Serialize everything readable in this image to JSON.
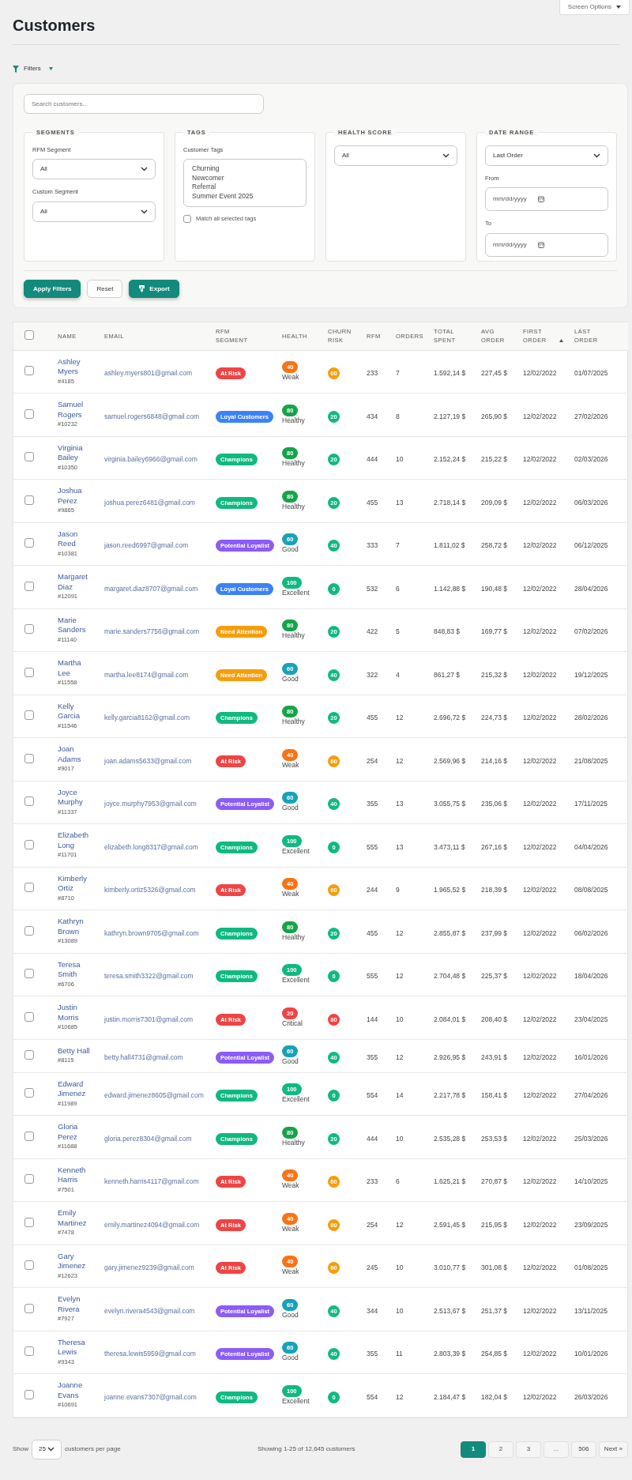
{
  "screen_options": {
    "label": "Screen Options",
    "expanded": false
  },
  "title": "Customers",
  "filters_toggle": {
    "label": "Filters",
    "expanded": true
  },
  "filters": {
    "search": {
      "placeholder": "Search customers..."
    },
    "groups": [
      {
        "legend": "SEGMENTS",
        "fields": [
          {
            "kind": "select",
            "label": "RFM Segment",
            "value": "All"
          },
          {
            "kind": "select",
            "label": "Custom Segment",
            "value": "All"
          }
        ]
      },
      {
        "legend": "TAGS",
        "fields": [
          {
            "kind": "listbox",
            "label": "Customer Tags",
            "options": [
              "Churning",
              "Newcomer",
              "Referral",
              "Summer Event 2025"
            ]
          },
          {
            "kind": "checkbox",
            "label": "Match all selected tags",
            "checked": false
          }
        ]
      },
      {
        "legend": "HEALTH SCORE",
        "fields": [
          {
            "kind": "select",
            "value": "All"
          }
        ]
      },
      {
        "legend": "DATE RANGE",
        "fields": [
          {
            "kind": "select",
            "value": "Last Order"
          },
          {
            "kind": "date",
            "label": "From",
            "placeholder": "mm/dd/yyyy"
          },
          {
            "kind": "date",
            "label": "To",
            "placeholder": "mm/dd/yyyy"
          }
        ]
      }
    ],
    "actions": [
      {
        "kind": "primary",
        "label": "Apply Filters"
      },
      {
        "kind": "secondary",
        "label": "Reset"
      },
      {
        "kind": "export",
        "label": "Export"
      }
    ]
  },
  "table": {
    "select_all": {
      "checked": false
    },
    "columns": [
      {
        "label": "NAME"
      },
      {
        "label": "EMAIL"
      },
      {
        "label": "RFM SEGMENT"
      },
      {
        "label": "HEALTH"
      },
      {
        "label": "CHURN RISK"
      },
      {
        "label": "RFM"
      },
      {
        "label": "ORDERS"
      },
      {
        "label": "TOTAL SPENT"
      },
      {
        "label": "AVG ORDER"
      },
      {
        "label": "FIRST ORDER",
        "sort_ascending": true
      },
      {
        "label": "LAST ORDER"
      }
    ],
    "rows": [
      {
        "checked": false,
        "name": "Ashley Myers",
        "id": "#4185",
        "email": "ashley.myers801@gmail.com",
        "segment": {
          "label": "At Risk",
          "color": "#ef4444"
        },
        "health": {
          "score": "40",
          "label": "Weak",
          "color": "#f97316"
        },
        "churn": {
          "value": "60",
          "color": "#f59e0b"
        },
        "rfm": "233",
        "orders": "7",
        "total_spent": "1.592,14 $",
        "avg_order": "227,45 $",
        "first_order": "12/02/2022",
        "last_order": "01/07/2025"
      },
      {
        "checked": false,
        "name": "Samuel Rogers",
        "id": "#10232",
        "email": "samuel.rogers6848@gmail.com",
        "segment": {
          "label": "Loyal Customers",
          "color": "#3b82f6"
        },
        "health": {
          "score": "80",
          "label": "Healthy",
          "color": "#16a34a"
        },
        "churn": {
          "value": "20",
          "color": "#10b981"
        },
        "rfm": "434",
        "orders": "8",
        "total_spent": "2.127,19 $",
        "avg_order": "265,90 $",
        "first_order": "12/02/2022",
        "last_order": "27/02/2026"
      },
      {
        "checked": false,
        "name": "Virginia Bailey",
        "id": "#10350",
        "email": "virginia.bailey6966@gmail.com",
        "segment": {
          "label": "Champions",
          "color": "#10b981"
        },
        "health": {
          "score": "80",
          "label": "Healthy",
          "color": "#16a34a"
        },
        "churn": {
          "value": "20",
          "color": "#10b981"
        },
        "rfm": "444",
        "orders": "10",
        "total_spent": "2.152,24 $",
        "avg_order": "215,22 $",
        "first_order": "12/02/2022",
        "last_order": "02/03/2026"
      },
      {
        "checked": false,
        "name": "Joshua Perez",
        "id": "#9865",
        "email": "joshua.perez6481@gmail.com",
        "segment": {
          "label": "Champions",
          "color": "#10b981"
        },
        "health": {
          "score": "80",
          "label": "Healthy",
          "color": "#16a34a"
        },
        "churn": {
          "value": "20",
          "color": "#10b981"
        },
        "rfm": "455",
        "orders": "13",
        "total_spent": "2.718,14 $",
        "avg_order": "209,09 $",
        "first_order": "12/02/2022",
        "last_order": "06/03/2026"
      },
      {
        "checked": false,
        "name": "Jason Reed",
        "id": "#10381",
        "email": "jason.reed6997@gmail.com",
        "segment": {
          "label": "Potential Loyalist",
          "color": "#8b5cf6"
        },
        "health": {
          "score": "60",
          "label": "Good",
          "color": "#17a2b8"
        },
        "churn": {
          "value": "40",
          "color": "#10b981"
        },
        "rfm": "333",
        "orders": "7",
        "total_spent": "1.811,02 $",
        "avg_order": "258,72 $",
        "first_order": "12/02/2022",
        "last_order": "06/12/2025"
      },
      {
        "checked": false,
        "name": "Margaret Diaz",
        "id": "#12091",
        "email": "margaret.diaz8707@gmail.com",
        "segment": {
          "label": "Loyal Customers",
          "color": "#3b82f6"
        },
        "health": {
          "score": "100",
          "label": "Excellent",
          "color": "#10b981"
        },
        "churn": {
          "value": "0",
          "color": "#10b981"
        },
        "rfm": "532",
        "orders": "6",
        "total_spent": "1.142,88 $",
        "avg_order": "190,48 $",
        "first_order": "12/02/2022",
        "last_order": "28/04/2026"
      },
      {
        "checked": false,
        "name": "Marie Sanders",
        "id": "#11140",
        "email": "marie.sanders7756@gmail.com",
        "segment": {
          "label": "Need Attention",
          "color": "#f59e0b"
        },
        "health": {
          "score": "80",
          "label": "Healthy",
          "color": "#16a34a"
        },
        "churn": {
          "value": "20",
          "color": "#10b981"
        },
        "rfm": "422",
        "orders": "5",
        "total_spent": "848,83 $",
        "avg_order": "169,77 $",
        "first_order": "12/02/2022",
        "last_order": "07/02/2026"
      },
      {
        "checked": false,
        "name": "Martha Lee",
        "id": "#11558",
        "email": "martha.lee8174@gmail.com",
        "segment": {
          "label": "Need Attention",
          "color": "#f59e0b"
        },
        "health": {
          "score": "60",
          "label": "Good",
          "color": "#17a2b8"
        },
        "churn": {
          "value": "40",
          "color": "#10b981"
        },
        "rfm": "322",
        "orders": "4",
        "total_spent": "861,27 $",
        "avg_order": "215,32 $",
        "first_order": "12/02/2022",
        "last_order": "19/12/2025"
      },
      {
        "checked": false,
        "name": "Kelly Garcia",
        "id": "#11546",
        "email": "kelly.garcia8162@gmail.com",
        "segment": {
          "label": "Champions",
          "color": "#10b981"
        },
        "health": {
          "score": "80",
          "label": "Healthy",
          "color": "#16a34a"
        },
        "churn": {
          "value": "20",
          "color": "#10b981"
        },
        "rfm": "455",
        "orders": "12",
        "total_spent": "2.696,72 $",
        "avg_order": "224,73 $",
        "first_order": "12/02/2022",
        "last_order": "28/02/2026"
      },
      {
        "checked": false,
        "name": "Joan Adams",
        "id": "#9017",
        "email": "joan.adams5633@gmail.com",
        "segment": {
          "label": "At Risk",
          "color": "#ef4444"
        },
        "health": {
          "score": "40",
          "label": "Weak",
          "color": "#f97316"
        },
        "churn": {
          "value": "60",
          "color": "#f59e0b"
        },
        "rfm": "254",
        "orders": "12",
        "total_spent": "2.569,96 $",
        "avg_order": "214,16 $",
        "first_order": "12/02/2022",
        "last_order": "21/08/2025"
      },
      {
        "checked": false,
        "name": "Joyce Murphy",
        "id": "#11337",
        "email": "joyce.murphy7953@gmail.com",
        "segment": {
          "label": "Potential Loyalist",
          "color": "#8b5cf6"
        },
        "health": {
          "score": "60",
          "label": "Good",
          "color": "#17a2b8"
        },
        "churn": {
          "value": "40",
          "color": "#10b981"
        },
        "rfm": "355",
        "orders": "13",
        "total_spent": "3.055,75 $",
        "avg_order": "235,06 $",
        "first_order": "12/02/2022",
        "last_order": "17/11/2025"
      },
      {
        "checked": false,
        "name": "Elizabeth Long",
        "id": "#11701",
        "email": "elizabeth.long8317@gmail.com",
        "segment": {
          "label": "Champions",
          "color": "#10b981"
        },
        "health": {
          "score": "100",
          "label": "Excellent",
          "color": "#10b981"
        },
        "churn": {
          "value": "0",
          "color": "#10b981"
        },
        "rfm": "555",
        "orders": "13",
        "total_spent": "3.473,11 $",
        "avg_order": "267,16 $",
        "first_order": "12/02/2022",
        "last_order": "04/04/2026"
      },
      {
        "checked": false,
        "name": "Kimberly Ortiz",
        "id": "#8710",
        "email": "kimberly.ortiz5326@gmail.com",
        "segment": {
          "label": "At Risk",
          "color": "#ef4444"
        },
        "health": {
          "score": "40",
          "label": "Weak",
          "color": "#f97316"
        },
        "churn": {
          "value": "60",
          "color": "#f59e0b"
        },
        "rfm": "244",
        "orders": "9",
        "total_spent": "1.965,52 $",
        "avg_order": "218,39 $",
        "first_order": "12/02/2022",
        "last_order": "08/08/2025"
      },
      {
        "checked": false,
        "name": "Kathryn Brown",
        "id": "#13089",
        "email": "kathryn.brown9705@gmail.com",
        "segment": {
          "label": "Champions",
          "color": "#10b981"
        },
        "health": {
          "score": "80",
          "label": "Healthy",
          "color": "#16a34a"
        },
        "churn": {
          "value": "20",
          "color": "#10b981"
        },
        "rfm": "455",
        "orders": "12",
        "total_spent": "2.855,87 $",
        "avg_order": "237,99 $",
        "first_order": "12/02/2022",
        "last_order": "06/02/2026"
      },
      {
        "checked": false,
        "name": "Teresa Smith",
        "id": "#6706",
        "email": "teresa.smith3322@gmail.com",
        "segment": {
          "label": "Champions",
          "color": "#10b981"
        },
        "health": {
          "score": "100",
          "label": "Excellent",
          "color": "#10b981"
        },
        "churn": {
          "value": "0",
          "color": "#10b981"
        },
        "rfm": "555",
        "orders": "12",
        "total_spent": "2.704,48 $",
        "avg_order": "225,37 $",
        "first_order": "12/02/2022",
        "last_order": "18/04/2026"
      },
      {
        "checked": false,
        "name": "Justin Morris",
        "id": "#10685",
        "email": "justin.morris7301@gmail.com",
        "segment": {
          "label": "At Risk",
          "color": "#ef4444"
        },
        "health": {
          "score": "20",
          "label": "Critical",
          "color": "#ef4444"
        },
        "churn": {
          "value": "80",
          "color": "#ef4444"
        },
        "rfm": "144",
        "orders": "10",
        "total_spent": "2.084,01 $",
        "avg_order": "208,40 $",
        "first_order": "12/02/2022",
        "last_order": "23/04/2025"
      },
      {
        "checked": false,
        "name": "Betty Hall",
        "id": "#8115",
        "email": "betty.hall4731@gmail.com",
        "segment": {
          "label": "Potential Loyalist",
          "color": "#8b5cf6"
        },
        "health": {
          "score": "60",
          "label": "Good",
          "color": "#17a2b8"
        },
        "churn": {
          "value": "40",
          "color": "#10b981"
        },
        "rfm": "355",
        "orders": "12",
        "total_spent": "2.926,95 $",
        "avg_order": "243,91 $",
        "first_order": "12/02/2022",
        "last_order": "16/01/2026"
      },
      {
        "checked": false,
        "name": "Edward Jimenez",
        "id": "#11989",
        "email": "edward.jimenez8605@gmail.com",
        "segment": {
          "label": "Champions",
          "color": "#10b981"
        },
        "health": {
          "score": "100",
          "label": "Excellent",
          "color": "#10b981"
        },
        "churn": {
          "value": "0",
          "color": "#10b981"
        },
        "rfm": "554",
        "orders": "14",
        "total_spent": "2.217,78 $",
        "avg_order": "158,41 $",
        "first_order": "12/02/2022",
        "last_order": "27/04/2026"
      },
      {
        "checked": false,
        "name": "Gloria Perez",
        "id": "#11688",
        "email": "gloria.perez8304@gmail.com",
        "segment": {
          "label": "Champions",
          "color": "#10b981"
        },
        "health": {
          "score": "80",
          "label": "Healthy",
          "color": "#16a34a"
        },
        "churn": {
          "value": "20",
          "color": "#10b981"
        },
        "rfm": "444",
        "orders": "10",
        "total_spent": "2.535,28 $",
        "avg_order": "253,53 $",
        "first_order": "12/02/2022",
        "last_order": "25/03/2026"
      },
      {
        "checked": false,
        "name": "Kenneth Harris",
        "id": "#7501",
        "email": "kenneth.harris4117@gmail.com",
        "segment": {
          "label": "At Risk",
          "color": "#ef4444"
        },
        "health": {
          "score": "40",
          "label": "Weak",
          "color": "#f97316"
        },
        "churn": {
          "value": "60",
          "color": "#f59e0b"
        },
        "rfm": "233",
        "orders": "6",
        "total_spent": "1.625,21 $",
        "avg_order": "270,87 $",
        "first_order": "12/02/2022",
        "last_order": "14/10/2025"
      },
      {
        "checked": false,
        "name": "Emily Martinez",
        "id": "#7478",
        "email": "emily.martinez4094@gmail.com",
        "segment": {
          "label": "At Risk",
          "color": "#ef4444"
        },
        "health": {
          "score": "40",
          "label": "Weak",
          "color": "#f97316"
        },
        "churn": {
          "value": "60",
          "color": "#f59e0b"
        },
        "rfm": "254",
        "orders": "12",
        "total_spent": "2.591,45 $",
        "avg_order": "215,95 $",
        "first_order": "12/02/2022",
        "last_order": "23/09/2025"
      },
      {
        "checked": false,
        "name": "Gary Jimenez",
        "id": "#12623",
        "email": "gary.jimenez9239@gmail.com",
        "segment": {
          "label": "At Risk",
          "color": "#ef4444"
        },
        "health": {
          "score": "40",
          "label": "Weak",
          "color": "#f97316"
        },
        "churn": {
          "value": "60",
          "color": "#f59e0b"
        },
        "rfm": "245",
        "orders": "10",
        "total_spent": "3.010,77 $",
        "avg_order": "301,08 $",
        "first_order": "12/02/2022",
        "last_order": "01/08/2025"
      },
      {
        "checked": false,
        "name": "Evelyn Rivera",
        "id": "#7927",
        "email": "evelyn.rivera4543@gmail.com",
        "segment": {
          "label": "Potential Loyalist",
          "color": "#8b5cf6"
        },
        "health": {
          "score": "60",
          "label": "Good",
          "color": "#17a2b8"
        },
        "churn": {
          "value": "40",
          "color": "#10b981"
        },
        "rfm": "344",
        "orders": "10",
        "total_spent": "2.513,67 $",
        "avg_order": "251,37 $",
        "first_order": "12/02/2022",
        "last_order": "13/11/2025"
      },
      {
        "checked": false,
        "name": "Theresa Lewis",
        "id": "#9343",
        "email": "theresa.lewis5959@gmail.com",
        "segment": {
          "label": "Potential Loyalist",
          "color": "#8b5cf6"
        },
        "health": {
          "score": "60",
          "label": "Good",
          "color": "#17a2b8"
        },
        "churn": {
          "value": "40",
          "color": "#10b981"
        },
        "rfm": "355",
        "orders": "11",
        "total_spent": "2.803,39 $",
        "avg_order": "254,85 $",
        "first_order": "12/02/2022",
        "last_order": "10/01/2026"
      },
      {
        "checked": false,
        "name": "Joanne Evans",
        "id": "#10691",
        "email": "joanne.evans7307@gmail.com",
        "segment": {
          "label": "Champions",
          "color": "#10b981"
        },
        "health": {
          "score": "100",
          "label": "Excellent",
          "color": "#10b981"
        },
        "churn": {
          "value": "0",
          "color": "#10b981"
        },
        "rfm": "554",
        "orders": "12",
        "total_spent": "2.184,47 $",
        "avg_order": "182,04 $",
        "first_order": "12/02/2022",
        "last_order": "26/03/2026"
      }
    ]
  },
  "footer": {
    "show_label": "Show",
    "per_page": "25",
    "per_page_label": "customers per page",
    "summary": "Showing 1-25 of 12,645 customers",
    "pages": [
      {
        "label": "1",
        "selected": true
      },
      {
        "label": "2",
        "selected": false
      },
      {
        "label": "3",
        "selected": false
      },
      {
        "label": "...",
        "selected": false
      },
      {
        "label": "506",
        "selected": false
      },
      {
        "label": "Next »",
        "selected": false
      }
    ]
  }
}
